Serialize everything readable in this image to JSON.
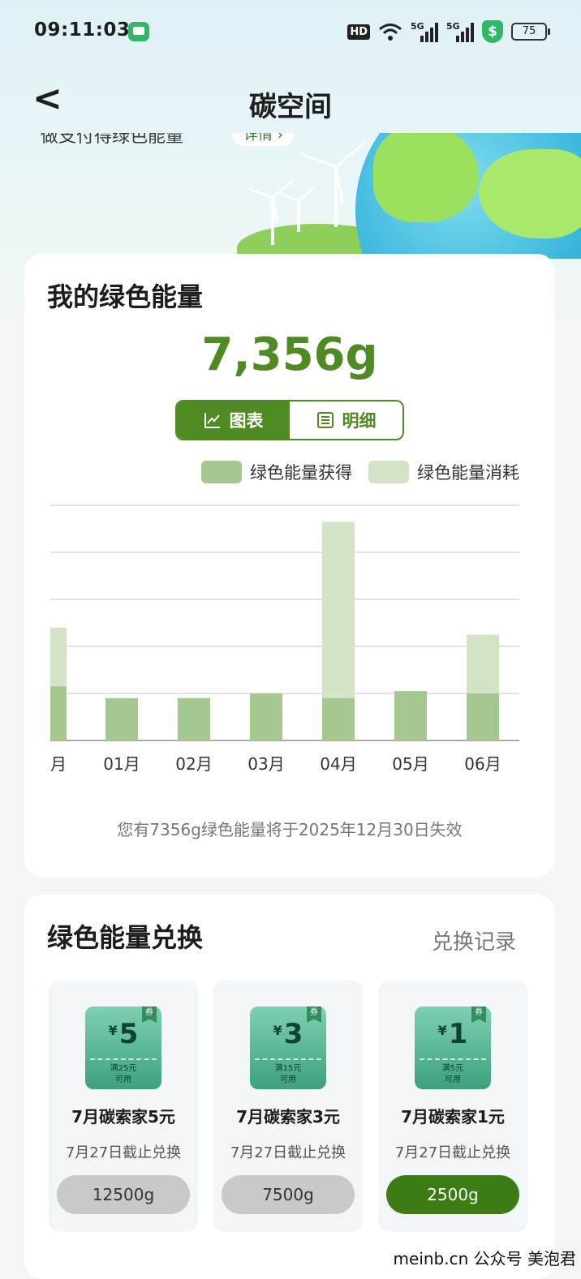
{
  "status": {
    "time": "09:11:03",
    "hd": "HD",
    "net1": "5G",
    "net2": "5G",
    "shield": "$",
    "battery": "75"
  },
  "nav": {
    "back_glyph": "<",
    "title": "碳空间"
  },
  "banner": {
    "text": "做支付得绿色能量",
    "link": "详情 ›"
  },
  "energy": {
    "title": "我的绿色能量",
    "total": "7,356g",
    "tabs": [
      {
        "label": "图表",
        "icon": "line-chart-icon"
      },
      {
        "label": "明细",
        "icon": "list-icon"
      }
    ],
    "legend": [
      {
        "label": "绿色能量获得",
        "color": "#a5c790"
      },
      {
        "label": "绿色能量消耗",
        "color": "#d3e4c6"
      }
    ],
    "note": "您有7356g绿色能量将于2025年12月30日失效"
  },
  "chart_data": {
    "type": "bar",
    "categories": [
      "月",
      "01月",
      "02月",
      "03月",
      "04月",
      "05月",
      "06月"
    ],
    "series": [
      {
        "name": "绿色能量获得",
        "color": "#a5c790",
        "values": [
          23,
          18,
          18,
          20,
          18,
          21,
          20
        ]
      },
      {
        "name": "绿色能量消耗",
        "color": "#d3e4c6",
        "values": [
          48,
          0,
          0,
          0,
          93,
          0,
          45
        ]
      }
    ],
    "ylim": [
      0,
      100
    ],
    "grid": true,
    "legend": "top-right"
  },
  "exchange": {
    "title": "绿色能量兑换",
    "link": "兑换记录",
    "items": [
      {
        "amount": "5",
        "currency": "¥",
        "cond1": "满25元",
        "cond2": "可用",
        "tag": "券",
        "name": "7月碳索家5元",
        "deadline": "7月27日截止兑换",
        "cost": "12500g",
        "available": false
      },
      {
        "amount": "3",
        "currency": "¥",
        "cond1": "满15元",
        "cond2": "可用",
        "tag": "券",
        "name": "7月碳索家3元",
        "deadline": "7月27日截止兑换",
        "cost": "7500g",
        "available": false
      },
      {
        "amount": "1",
        "currency": "¥",
        "cond1": "满5元",
        "cond2": "可用",
        "tag": "券",
        "name": "7月碳索家1元",
        "deadline": "7月27日截止兑换",
        "cost": "2500g",
        "available": true
      }
    ]
  },
  "watermark": "meinb.cn 公众号 美泡君"
}
